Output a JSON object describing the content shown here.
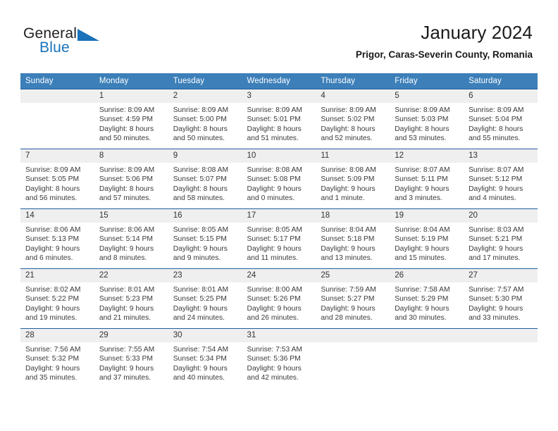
{
  "brand": {
    "name_part1": "General",
    "name_part2": "Blue"
  },
  "header": {
    "month_title": "January 2024",
    "location": "Prigor, Caras-Severin County, Romania"
  },
  "colors": {
    "header_blue": "#3c7fb9",
    "row_divider_blue": "#205f9e",
    "daynum_band": "#efefef",
    "brand_blue": "#1a72ba",
    "text": "#3a3a3a"
  },
  "weekday_headers": [
    "Sunday",
    "Monday",
    "Tuesday",
    "Wednesday",
    "Thursday",
    "Friday",
    "Saturday"
  ],
  "labels": {
    "sunrise_prefix": "Sunrise:",
    "sunset_prefix": "Sunset:",
    "daylight_prefix": "Daylight:"
  },
  "weeks": [
    [
      {
        "empty": true,
        "day": "",
        "sunrise": "",
        "sunset": "",
        "daylight_line1": "",
        "daylight_line2": ""
      },
      {
        "empty": false,
        "day": "1",
        "sunrise": "Sunrise: 8:09 AM",
        "sunset": "Sunset: 4:59 PM",
        "daylight_line1": "Daylight: 8 hours",
        "daylight_line2": "and 50 minutes."
      },
      {
        "empty": false,
        "day": "2",
        "sunrise": "Sunrise: 8:09 AM",
        "sunset": "Sunset: 5:00 PM",
        "daylight_line1": "Daylight: 8 hours",
        "daylight_line2": "and 50 minutes."
      },
      {
        "empty": false,
        "day": "3",
        "sunrise": "Sunrise: 8:09 AM",
        "sunset": "Sunset: 5:01 PM",
        "daylight_line1": "Daylight: 8 hours",
        "daylight_line2": "and 51 minutes."
      },
      {
        "empty": false,
        "day": "4",
        "sunrise": "Sunrise: 8:09 AM",
        "sunset": "Sunset: 5:02 PM",
        "daylight_line1": "Daylight: 8 hours",
        "daylight_line2": "and 52 minutes."
      },
      {
        "empty": false,
        "day": "5",
        "sunrise": "Sunrise: 8:09 AM",
        "sunset": "Sunset: 5:03 PM",
        "daylight_line1": "Daylight: 8 hours",
        "daylight_line2": "and 53 minutes."
      },
      {
        "empty": false,
        "day": "6",
        "sunrise": "Sunrise: 8:09 AM",
        "sunset": "Sunset: 5:04 PM",
        "daylight_line1": "Daylight: 8 hours",
        "daylight_line2": "and 55 minutes."
      }
    ],
    [
      {
        "empty": false,
        "day": "7",
        "sunrise": "Sunrise: 8:09 AM",
        "sunset": "Sunset: 5:05 PM",
        "daylight_line1": "Daylight: 8 hours",
        "daylight_line2": "and 56 minutes."
      },
      {
        "empty": false,
        "day": "8",
        "sunrise": "Sunrise: 8:09 AM",
        "sunset": "Sunset: 5:06 PM",
        "daylight_line1": "Daylight: 8 hours",
        "daylight_line2": "and 57 minutes."
      },
      {
        "empty": false,
        "day": "9",
        "sunrise": "Sunrise: 8:08 AM",
        "sunset": "Sunset: 5:07 PM",
        "daylight_line1": "Daylight: 8 hours",
        "daylight_line2": "and 58 minutes."
      },
      {
        "empty": false,
        "day": "10",
        "sunrise": "Sunrise: 8:08 AM",
        "sunset": "Sunset: 5:08 PM",
        "daylight_line1": "Daylight: 9 hours",
        "daylight_line2": "and 0 minutes."
      },
      {
        "empty": false,
        "day": "11",
        "sunrise": "Sunrise: 8:08 AM",
        "sunset": "Sunset: 5:09 PM",
        "daylight_line1": "Daylight: 9 hours",
        "daylight_line2": "and 1 minute."
      },
      {
        "empty": false,
        "day": "12",
        "sunrise": "Sunrise: 8:07 AM",
        "sunset": "Sunset: 5:11 PM",
        "daylight_line1": "Daylight: 9 hours",
        "daylight_line2": "and 3 minutes."
      },
      {
        "empty": false,
        "day": "13",
        "sunrise": "Sunrise: 8:07 AM",
        "sunset": "Sunset: 5:12 PM",
        "daylight_line1": "Daylight: 9 hours",
        "daylight_line2": "and 4 minutes."
      }
    ],
    [
      {
        "empty": false,
        "day": "14",
        "sunrise": "Sunrise: 8:06 AM",
        "sunset": "Sunset: 5:13 PM",
        "daylight_line1": "Daylight: 9 hours",
        "daylight_line2": "and 6 minutes."
      },
      {
        "empty": false,
        "day": "15",
        "sunrise": "Sunrise: 8:06 AM",
        "sunset": "Sunset: 5:14 PM",
        "daylight_line1": "Daylight: 9 hours",
        "daylight_line2": "and 8 minutes."
      },
      {
        "empty": false,
        "day": "16",
        "sunrise": "Sunrise: 8:05 AM",
        "sunset": "Sunset: 5:15 PM",
        "daylight_line1": "Daylight: 9 hours",
        "daylight_line2": "and 9 minutes."
      },
      {
        "empty": false,
        "day": "17",
        "sunrise": "Sunrise: 8:05 AM",
        "sunset": "Sunset: 5:17 PM",
        "daylight_line1": "Daylight: 9 hours",
        "daylight_line2": "and 11 minutes."
      },
      {
        "empty": false,
        "day": "18",
        "sunrise": "Sunrise: 8:04 AM",
        "sunset": "Sunset: 5:18 PM",
        "daylight_line1": "Daylight: 9 hours",
        "daylight_line2": "and 13 minutes."
      },
      {
        "empty": false,
        "day": "19",
        "sunrise": "Sunrise: 8:04 AM",
        "sunset": "Sunset: 5:19 PM",
        "daylight_line1": "Daylight: 9 hours",
        "daylight_line2": "and 15 minutes."
      },
      {
        "empty": false,
        "day": "20",
        "sunrise": "Sunrise: 8:03 AM",
        "sunset": "Sunset: 5:21 PM",
        "daylight_line1": "Daylight: 9 hours",
        "daylight_line2": "and 17 minutes."
      }
    ],
    [
      {
        "empty": false,
        "day": "21",
        "sunrise": "Sunrise: 8:02 AM",
        "sunset": "Sunset: 5:22 PM",
        "daylight_line1": "Daylight: 9 hours",
        "daylight_line2": "and 19 minutes."
      },
      {
        "empty": false,
        "day": "22",
        "sunrise": "Sunrise: 8:01 AM",
        "sunset": "Sunset: 5:23 PM",
        "daylight_line1": "Daylight: 9 hours",
        "daylight_line2": "and 21 minutes."
      },
      {
        "empty": false,
        "day": "23",
        "sunrise": "Sunrise: 8:01 AM",
        "sunset": "Sunset: 5:25 PM",
        "daylight_line1": "Daylight: 9 hours",
        "daylight_line2": "and 24 minutes."
      },
      {
        "empty": false,
        "day": "24",
        "sunrise": "Sunrise: 8:00 AM",
        "sunset": "Sunset: 5:26 PM",
        "daylight_line1": "Daylight: 9 hours",
        "daylight_line2": "and 26 minutes."
      },
      {
        "empty": false,
        "day": "25",
        "sunrise": "Sunrise: 7:59 AM",
        "sunset": "Sunset: 5:27 PM",
        "daylight_line1": "Daylight: 9 hours",
        "daylight_line2": "and 28 minutes."
      },
      {
        "empty": false,
        "day": "26",
        "sunrise": "Sunrise: 7:58 AM",
        "sunset": "Sunset: 5:29 PM",
        "daylight_line1": "Daylight: 9 hours",
        "daylight_line2": "and 30 minutes."
      },
      {
        "empty": false,
        "day": "27",
        "sunrise": "Sunrise: 7:57 AM",
        "sunset": "Sunset: 5:30 PM",
        "daylight_line1": "Daylight: 9 hours",
        "daylight_line2": "and 33 minutes."
      }
    ],
    [
      {
        "empty": false,
        "day": "28",
        "sunrise": "Sunrise: 7:56 AM",
        "sunset": "Sunset: 5:32 PM",
        "daylight_line1": "Daylight: 9 hours",
        "daylight_line2": "and 35 minutes."
      },
      {
        "empty": false,
        "day": "29",
        "sunrise": "Sunrise: 7:55 AM",
        "sunset": "Sunset: 5:33 PM",
        "daylight_line1": "Daylight: 9 hours",
        "daylight_line2": "and 37 minutes."
      },
      {
        "empty": false,
        "day": "30",
        "sunrise": "Sunrise: 7:54 AM",
        "sunset": "Sunset: 5:34 PM",
        "daylight_line1": "Daylight: 9 hours",
        "daylight_line2": "and 40 minutes."
      },
      {
        "empty": false,
        "day": "31",
        "sunrise": "Sunrise: 7:53 AM",
        "sunset": "Sunset: 5:36 PM",
        "daylight_line1": "Daylight: 9 hours",
        "daylight_line2": "and 42 minutes."
      },
      {
        "empty": true,
        "day": "",
        "sunrise": "",
        "sunset": "",
        "daylight_line1": "",
        "daylight_line2": ""
      },
      {
        "empty": true,
        "day": "",
        "sunrise": "",
        "sunset": "",
        "daylight_line1": "",
        "daylight_line2": ""
      },
      {
        "empty": true,
        "day": "",
        "sunrise": "",
        "sunset": "",
        "daylight_line1": "",
        "daylight_line2": ""
      }
    ]
  ]
}
